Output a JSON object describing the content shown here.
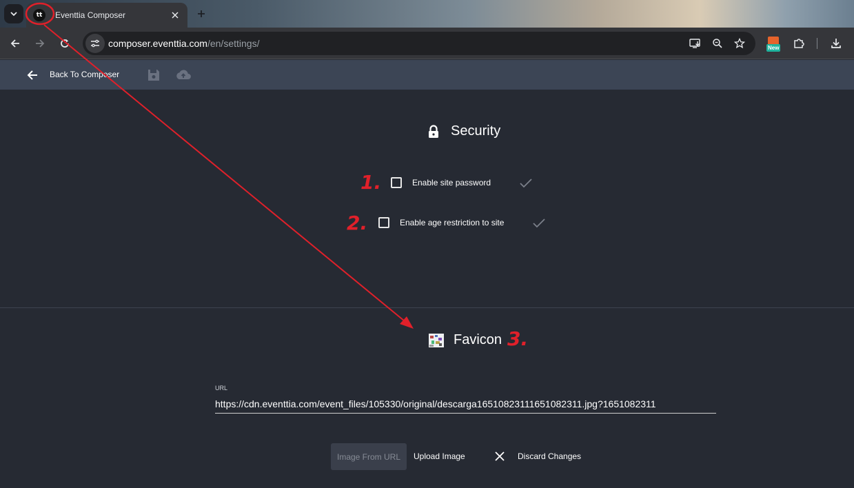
{
  "browser": {
    "tab": {
      "title": "Eventtia Composer",
      "favicon_text": "tt"
    },
    "url": {
      "host": "composer.eventtia.com",
      "path": "/en/settings/"
    },
    "extension_badge": "New"
  },
  "header": {
    "back_label": "Back To Composer"
  },
  "security": {
    "title": "Security",
    "options": [
      {
        "label": "Enable site password",
        "checked": false
      },
      {
        "label": "Enable age restriction to site",
        "checked": false
      }
    ]
  },
  "favicon": {
    "title": "Favicon",
    "url_label": "URL",
    "url_value": "https://cdn.eventtia.com/event_files/105330/original/descarga16510823111651082311.jpg?1651082311",
    "buttons": {
      "image_from_url": "Image From URL",
      "upload": "Upload Image",
      "discard": "Discard Changes"
    }
  },
  "annotations": {
    "n1": "1.",
    "n2": "2.",
    "n3": "3."
  },
  "colors": {
    "page_bg": "#262a33",
    "header_bg": "#3c4555",
    "annotation": "#e0202a"
  }
}
